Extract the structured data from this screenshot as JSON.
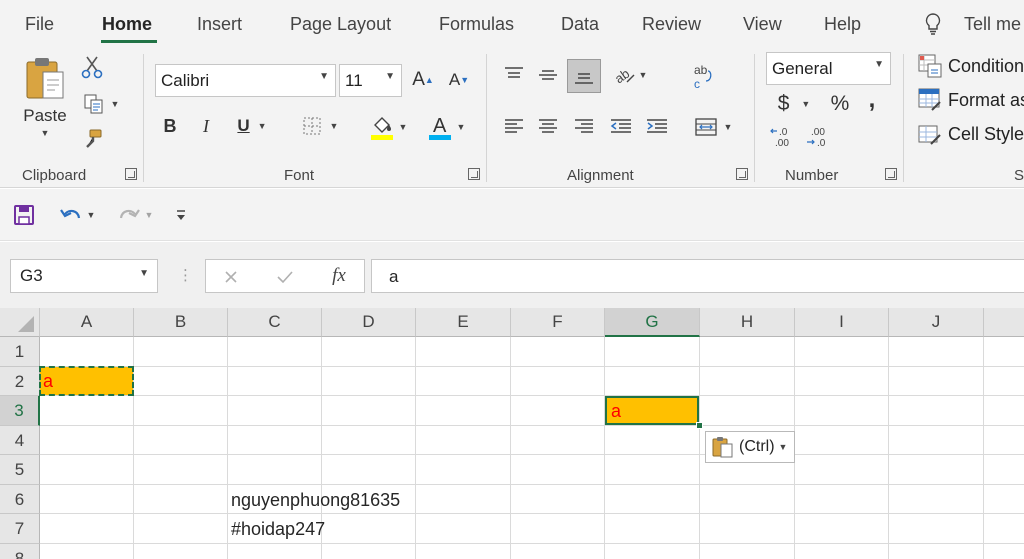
{
  "tabs": [
    "File",
    "Home",
    "Insert",
    "Page Layout",
    "Formulas",
    "Data",
    "Review",
    "View",
    "Help"
  ],
  "tell_me": "Tell me",
  "clipboard": {
    "paste_label": "Paste",
    "group_label": "Clipboard"
  },
  "font": {
    "name": "Calibri",
    "size": "11",
    "group_label": "Font"
  },
  "alignment": {
    "group_label": "Alignment"
  },
  "number": {
    "format": "General",
    "currency": "$",
    "percent": "%",
    "comma": ",",
    "group_label": "Number"
  },
  "styles": {
    "conditional": "Conditional",
    "format_as": "Format as",
    "cell_styles": "Cell Styles",
    "group_label_partial": "S"
  },
  "formula_bar": {
    "name_box": "G3",
    "fx": "fx",
    "content": "a"
  },
  "columns": [
    "A",
    "B",
    "C",
    "D",
    "E",
    "F",
    "G",
    "H",
    "I",
    "J"
  ],
  "rows": [
    "1",
    "2",
    "3",
    "4",
    "5",
    "6",
    "7",
    "8"
  ],
  "selected_column": "G",
  "selected_row": "3",
  "cells": {
    "A2": "a",
    "G3": "a",
    "C6": "nguyenphuong81635",
    "C7": "#hoidap247"
  },
  "paste_options": {
    "label": "(Ctrl)"
  },
  "colors": {
    "accent": "#217346",
    "cell_fill": "#FFC000",
    "cell_text": "#FF0000",
    "highlight_bar": "#FFFF00",
    "font_color_bar": "#00B0F0"
  }
}
